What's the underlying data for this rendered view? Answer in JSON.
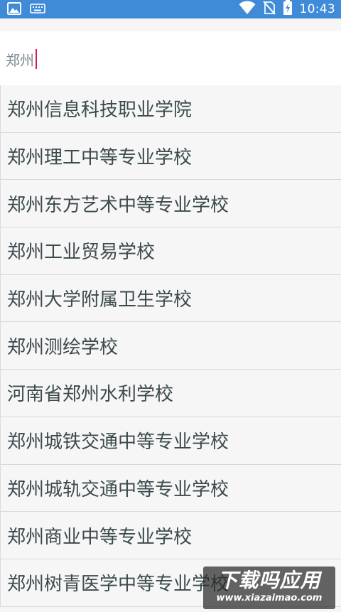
{
  "status_bar": {
    "time": "10:43",
    "background_color": "#3f8bd8",
    "left_icons": [
      "image-icon",
      "keyboard-icon"
    ],
    "right_icons": [
      "wifi-icon",
      "no-sim-icon",
      "battery-charging-icon"
    ]
  },
  "search": {
    "value": "郑州",
    "cursor_color": "#d81b60"
  },
  "results": [
    "郑州信息科技职业学院",
    "郑州理工中等专业学校",
    "郑州东方艺术中等专业学校",
    "郑州工业贸易学校",
    "郑州大学附属卫生学校",
    "郑州测绘学校",
    "河南省郑州水利学校",
    "郑州城铁交通中等专业学校",
    "郑州城轨交通中等专业学校",
    "郑州商业中等专业学校",
    "郑州树青医学中等专业学校"
  ],
  "watermark": {
    "title": "下载吗应用",
    "url": "www.xiazaimao.com"
  }
}
